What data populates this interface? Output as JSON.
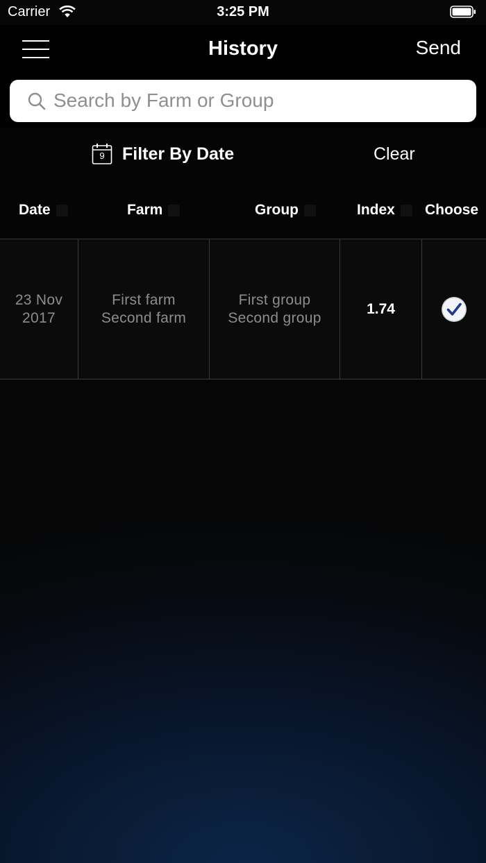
{
  "status_bar": {
    "carrier": "Carrier",
    "time": "3:25 PM"
  },
  "nav": {
    "title": "History",
    "send_label": "Send"
  },
  "search": {
    "placeholder": "Search by Farm or Group",
    "value": ""
  },
  "filter": {
    "calendar_day": "9",
    "label": "Filter By Date",
    "clear_label": "Clear"
  },
  "table": {
    "columns": [
      "Date",
      "Farm",
      "Group",
      "Index",
      "Choose"
    ],
    "rows": [
      {
        "date_line1": "23 Nov",
        "date_line2": "2017",
        "farm_line1": "First farm",
        "farm_line2": "Second farm",
        "group_line1": "First group",
        "group_line2": "Second group",
        "index": "1.74",
        "chosen": true
      }
    ]
  },
  "colors": {
    "accent": "#1e3c8c",
    "background_glow": "#0b2547"
  }
}
